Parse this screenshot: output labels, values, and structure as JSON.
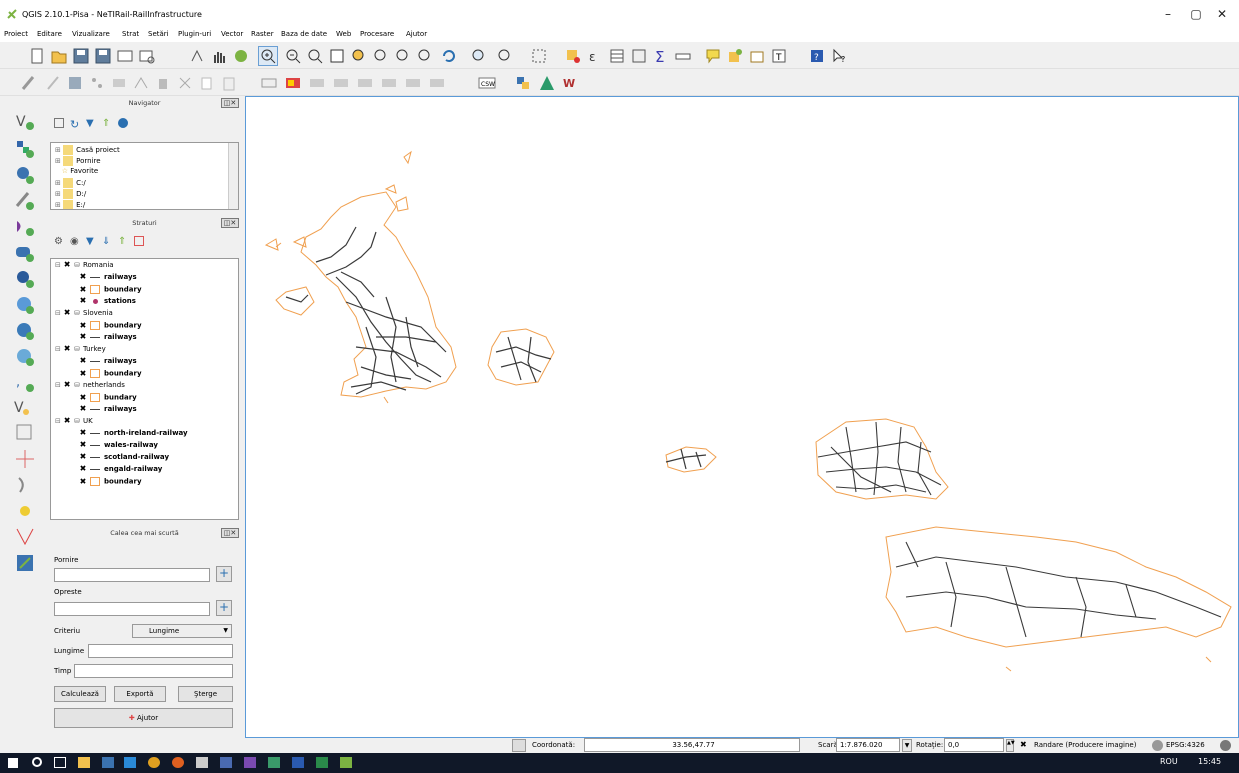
{
  "window": {
    "title": "QGIS 2.10.1-Pisa - NeTIRail-RailInfrastructure",
    "minimize": "–",
    "maximize": "▢",
    "close": "✕"
  },
  "menu": [
    "Proiect",
    "Editare",
    "Vizualizare",
    "Strat",
    "Setări",
    "Plugin-uri",
    "Vector",
    "Raster",
    "Baza de date",
    "Web",
    "Procesare",
    "Ajutor"
  ],
  "navigator": {
    "title": "Navigator",
    "items": [
      "Casă proiect",
      "Pornire",
      "Favorite",
      "C:/",
      "D:/",
      "E:/"
    ]
  },
  "layers": {
    "title": "Straturi",
    "groups": [
      {
        "name": "Romania",
        "children": [
          {
            "name": "railways",
            "type": "line"
          },
          {
            "name": "boundary",
            "type": "polygon"
          },
          {
            "name": "stations",
            "type": "point"
          }
        ]
      },
      {
        "name": "Slovenia",
        "children": [
          {
            "name": "boundary",
            "type": "polygon"
          },
          {
            "name": "railways",
            "type": "line"
          }
        ]
      },
      {
        "name": "Turkey",
        "children": [
          {
            "name": "railways",
            "type": "line"
          },
          {
            "name": "boundary",
            "type": "polygon"
          }
        ]
      },
      {
        "name": "netherlands",
        "children": [
          {
            "name": "bundary",
            "type": "polygon"
          },
          {
            "name": "railways",
            "type": "line"
          }
        ]
      },
      {
        "name": "UK",
        "children": [
          {
            "name": "north-ireland-railway",
            "type": "line"
          },
          {
            "name": "wales-railway",
            "type": "line"
          },
          {
            "name": "scotland-railway",
            "type": "line"
          },
          {
            "name": "engald-railway",
            "type": "line"
          },
          {
            "name": "boundary",
            "type": "polygon"
          }
        ]
      }
    ]
  },
  "shortest_path": {
    "title": "Calea cea mai scurtă",
    "start_label": "Pornire",
    "start_value": "",
    "stop_label": "Opreste",
    "stop_value": "",
    "criterion_label": "Criteriu",
    "criterion_value": "Lungime",
    "length_label": "Lungime",
    "length_value": "",
    "time_label": "Timp",
    "time_value": "",
    "calc_button": "Calculează",
    "export_button": "Exportă",
    "clear_button": "Şterge",
    "help_button": "Ajutor"
  },
  "status": {
    "coord_label": "Coordonată:",
    "coord_value": "33.56,47.77",
    "scale_label": "Scară",
    "scale_value": "1:7.876.020",
    "rotation_label": "Rotaţie:",
    "rotation_value": "0,0",
    "render_label": "Randare (Producere imagine)",
    "crs": "EPSG:4326"
  },
  "taskbar": {
    "lang": "ROU",
    "time": "15:45"
  },
  "colors": {
    "boundary": "#f0a050",
    "railway": "#3a3a3a",
    "map_border": "#5a9ad8"
  }
}
